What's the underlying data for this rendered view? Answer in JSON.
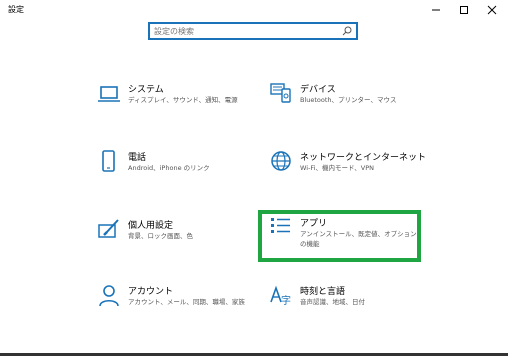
{
  "window": {
    "title": "設定"
  },
  "search": {
    "placeholder": "設定の検索"
  },
  "colors": {
    "accent": "#1a73b8",
    "highlight": "#1fa642"
  },
  "tiles": [
    {
      "name": "システム",
      "desc": "ディスプレイ、サウンド、通知、電源",
      "icon": "laptop-icon"
    },
    {
      "name": "デバイス",
      "desc": "Bluetooth、プリンター、マウス",
      "icon": "devices-icon"
    },
    {
      "name": "電話",
      "desc": "Android、iPhone のリンク",
      "icon": "phone-icon"
    },
    {
      "name": "ネットワークとインターネット",
      "desc": "Wi-Fi、機内モード、VPN",
      "icon": "globe-icon"
    },
    {
      "name": "個人用設定",
      "desc": "背景、ロック画面、色",
      "icon": "personalization-icon"
    },
    {
      "name": "アプリ",
      "desc": "アンインストール、既定値、オプションの機能",
      "icon": "apps-list-icon"
    },
    {
      "name": "アカウント",
      "desc": "アカウント、メール、同期、職場、家族",
      "icon": "person-icon"
    },
    {
      "name": "時刻と言語",
      "desc": "音声認識、地域、日付",
      "icon": "time-language-icon"
    }
  ]
}
